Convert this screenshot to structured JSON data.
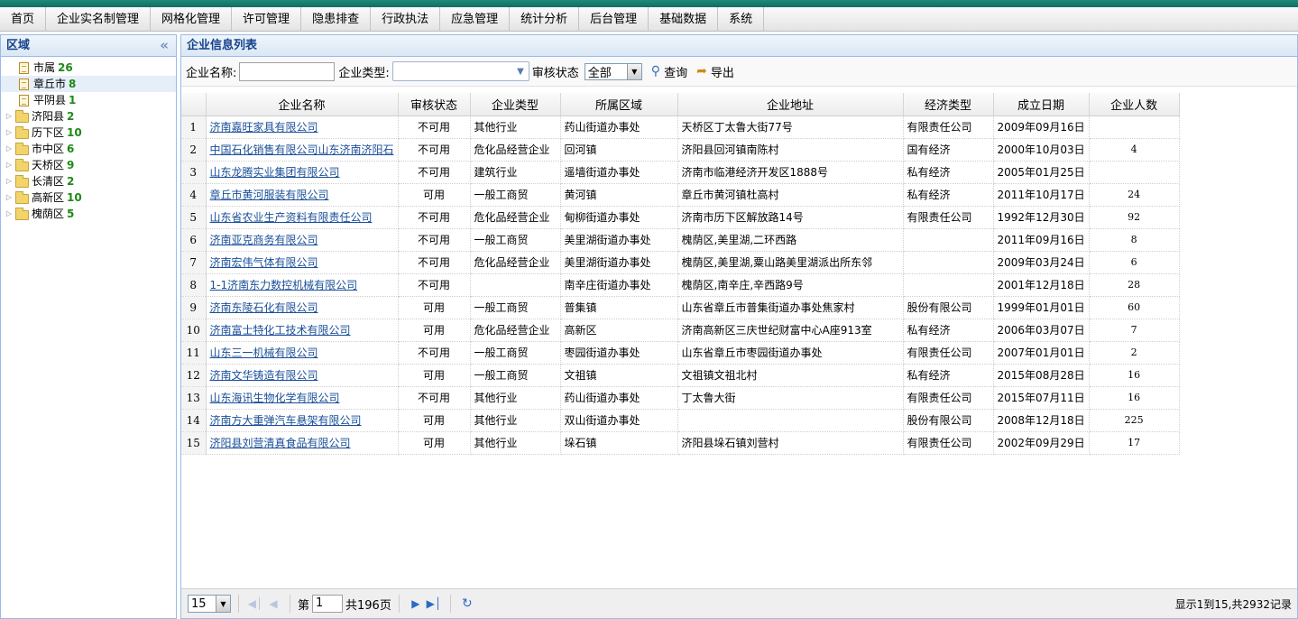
{
  "menu": [
    "首页",
    "企业实名制管理",
    "网格化管理",
    "许可管理",
    "隐患排查",
    "行政执法",
    "应急管理",
    "统计分析",
    "后台管理",
    "基础数据",
    "系统"
  ],
  "sidebar": {
    "title": "区域",
    "collapse_icon": "«",
    "nodes": [
      {
        "label": "市属",
        "count": "26",
        "type": "file",
        "selected": false
      },
      {
        "label": "章丘市",
        "count": "8",
        "type": "file",
        "selected": true
      },
      {
        "label": "平阴县",
        "count": "1",
        "type": "file",
        "selected": false
      },
      {
        "label": "济阳县",
        "count": "2",
        "type": "folder",
        "selected": false
      },
      {
        "label": "历下区",
        "count": "10",
        "type": "folder",
        "selected": false
      },
      {
        "label": "市中区",
        "count": "6",
        "type": "folder",
        "selected": false
      },
      {
        "label": "天桥区",
        "count": "9",
        "type": "folder",
        "selected": false
      },
      {
        "label": "长清区",
        "count": "2",
        "type": "folder",
        "selected": false
      },
      {
        "label": "高新区",
        "count": "10",
        "type": "folder",
        "selected": false
      },
      {
        "label": "槐荫区",
        "count": "5",
        "type": "folder",
        "selected": false
      }
    ]
  },
  "main": {
    "title": "企业信息列表",
    "filters": {
      "name_label": "企业名称:",
      "name_value": "",
      "type_label": "企业类型:",
      "type_value": "",
      "status_label": "审核状态",
      "status_value": "全部",
      "search_label": "查询",
      "export_label": "导出"
    },
    "columns": [
      "企业名称",
      "审核状态",
      "企业类型",
      "所属区域",
      "企业地址",
      "经济类型",
      "成立日期",
      "企业人数"
    ],
    "rows": [
      [
        "1",
        "济南嘉旺家具有限公司",
        "不可用",
        "其他行业",
        "药山街道办事处",
        "天桥区丁太鲁大街77号",
        "有限责任公司",
        "2009年09月16日",
        ""
      ],
      [
        "2",
        "中国石化销售有限公司山东济南济阳石",
        "不可用",
        "危化品经营企业",
        "回河镇",
        "济阳县回河镇南陈村",
        "国有经济",
        "2000年10月03日",
        "4"
      ],
      [
        "3",
        "山东龙腾实业集团有限公司",
        "不可用",
        "建筑行业",
        "遥墙街道办事处",
        "济南市临港经济开发区1888号",
        "私有经济",
        "2005年01月25日",
        ""
      ],
      [
        "4",
        "章丘市黄河服装有限公司",
        "可用",
        "一般工商贸",
        "黄河镇",
        "章丘市黄河镇杜高村",
        "私有经济",
        "2011年10月17日",
        "24"
      ],
      [
        "5",
        "山东省农业生产资料有限责任公司",
        "不可用",
        "危化品经营企业",
        "甸柳街道办事处",
        "济南市历下区解放路14号",
        "有限责任公司",
        "1992年12月30日",
        "92"
      ],
      [
        "6",
        "济南亚克商务有限公司",
        "不可用",
        "一般工商贸",
        "美里湖街道办事处",
        "槐荫区,美里湖,二环西路",
        "",
        "2011年09月16日",
        "8"
      ],
      [
        "7",
        "济南宏伟气体有限公司",
        "不可用",
        "危化品经营企业",
        "美里湖街道办事处",
        "槐荫区,美里湖,粟山路美里湖派出所东邻",
        "",
        "2009年03月24日",
        "6"
      ],
      [
        "8",
        "1-1济南东力数控机械有限公司",
        "不可用",
        "",
        "南辛庄街道办事处",
        "槐荫区,南辛庄,辛西路9号",
        "",
        "2001年12月18日",
        "28"
      ],
      [
        "9",
        "济南东陵石化有限公司",
        "可用",
        "一般工商贸",
        "普集镇",
        "山东省章丘市普集街道办事处焦家村",
        "股份有限公司",
        "1999年01月01日",
        "60"
      ],
      [
        "10",
        "济南富士特化工技术有限公司",
        "可用",
        "危化品经营企业",
        "高新区",
        "济南高新区三庆世纪财富中心A座913室",
        "私有经济",
        "2006年03月07日",
        "7"
      ],
      [
        "11",
        "山东三一机械有限公司",
        "不可用",
        "一般工商贸",
        "枣园街道办事处",
        "山东省章丘市枣园街道办事处",
        "有限责任公司",
        "2007年01月01日",
        "2"
      ],
      [
        "12",
        "济南文华铸造有限公司",
        "可用",
        "一般工商贸",
        "文祖镇",
        "文祖镇文祖北村",
        "私有经济",
        "2015年08月28日",
        "16"
      ],
      [
        "13",
        "山东海讯生物化学有限公司",
        "不可用",
        "其他行业",
        "药山街道办事处",
        "丁太鲁大街",
        "有限责任公司",
        "2015年07月11日",
        "16"
      ],
      [
        "14",
        "济南方大重弹汽车悬架有限公司",
        "可用",
        "其他行业",
        "双山街道办事处",
        "",
        "股份有限公司",
        "2008年12月18日",
        "225"
      ],
      [
        "15",
        "济阳县刘营清真食品有限公司",
        "可用",
        "其他行业",
        "垛石镇",
        "济阳县垛石镇刘营村",
        "有限责任公司",
        "2002年09月29日",
        "17"
      ]
    ]
  },
  "pager": {
    "page_size": "15",
    "page_prefix": "第",
    "page_value": "1",
    "page_total": "共196页",
    "info": "显示1到15,共2932记录"
  }
}
